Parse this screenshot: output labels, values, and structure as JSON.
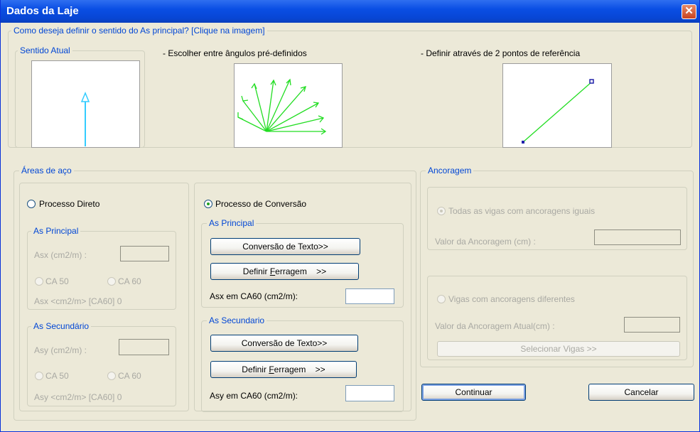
{
  "window": {
    "title": "Dados da Laje",
    "close_glyph": "✕"
  },
  "sentido": {
    "legend": "Como deseja definir o sentido do As principal? [Clique na imagem]",
    "atual_legend": "Sentido Atual",
    "angulos_label": "- Escolher entre ângulos pré-definidos",
    "pontos_label": "- Definir através de 2 pontos de referência"
  },
  "areas": {
    "legend": "Áreas de aço",
    "direto": {
      "radio_label": "Processo Direto",
      "principal_legend": "As Principal",
      "asx_label": "Asx (cm2/m) :",
      "ca50": "CA 50",
      "ca60": "CA 60",
      "asx_ca60": "Asx <cm2/m> [CA60] 0",
      "secundario_legend": "As Secundário",
      "asy_label": "Asy (cm2/m) :",
      "ca50_b": "CA 50",
      "ca60_b": "CA 60",
      "asy_ca60": "Asy <cm2/m> [CA60] 0"
    },
    "conversao": {
      "radio_label": "Processo de Conversão",
      "principal_legend": "As Principal",
      "conv_texto_btn": "Conversão de Texto>>",
      "def_ferragem_btn_pre": "Definir ",
      "def_ferragem_btn_u": "F",
      "def_ferragem_btn_post": "erragem    >>",
      "asx_label": "Asx em CA60 (cm2/m):",
      "asx_value": "",
      "secundario_legend": "As Secundario",
      "conv_texto_btn_2": "Conversão de Texto>>",
      "def_ferragem_btn_2_pre": "Definir ",
      "def_ferragem_btn_2_u": "F",
      "def_ferragem_btn_2_post": "erragem    >>",
      "asy_label": "Asy em CA60 (cm2/m):",
      "asy_value": ""
    }
  },
  "ancoragem": {
    "legend": "Ancoragem",
    "iguais_label": "Todas as vigas com ancoragens iguais",
    "valor_label": "Valor da Ancoragem (cm) :",
    "diferentes_label": "Vigas com ancoragens diferentes",
    "valor_atual_label": "Valor da Ancoragem Atual(cm) :",
    "selecionar_btn": "Selecionar Vigas >>"
  },
  "buttons": {
    "continuar": "Continuar",
    "cancelar": "Cancelar"
  },
  "colors": {
    "accent": "#0046d5",
    "arrow_current": "#33ccff",
    "arrows_green": "#22dd22",
    "point": "#2222aa"
  }
}
